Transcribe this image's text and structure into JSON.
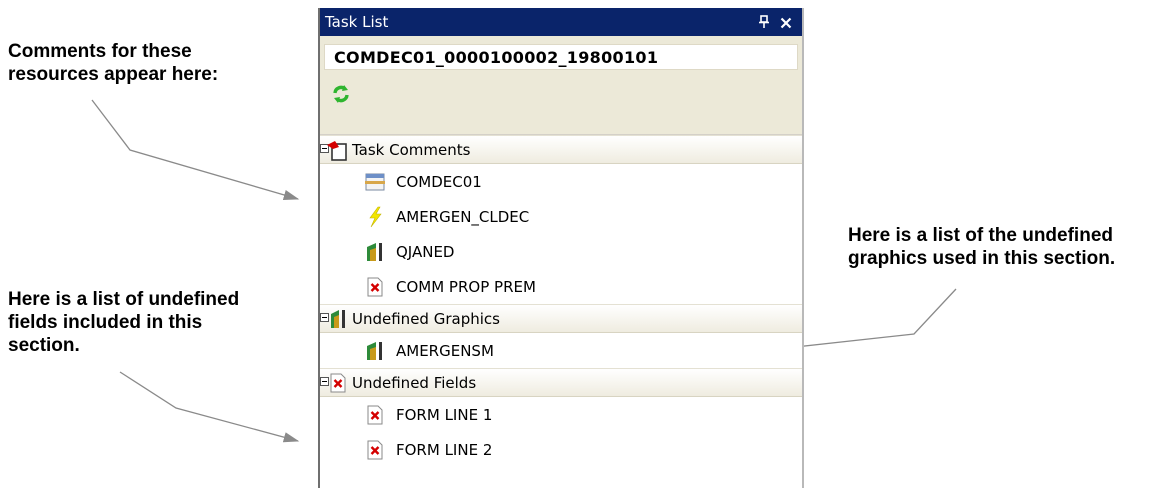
{
  "annotations": {
    "comments": [
      "Comments for these",
      "resources appear here:"
    ],
    "fields": [
      "Here is a list of undefined",
      "fields included in this",
      "section."
    ],
    "graphics": [
      "Here is a list of the undefined",
      "graphics used in this section."
    ]
  },
  "panel": {
    "title": "Task List",
    "pin_glyph": "⼌",
    "close_glyph": "✕",
    "resource_name": "COMDEC01_0000100002_19800101"
  },
  "groups": [
    {
      "label": "Task Comments",
      "icon": "task-comments-icon",
      "items": [
        {
          "label": "COMDEC01",
          "icon": "form-icon"
        },
        {
          "label": "AMERGEN_CLDEC",
          "icon": "lightning-icon"
        },
        {
          "label": "QJANED",
          "icon": "graphic-icon"
        },
        {
          "label": "COMM PROP PREM",
          "icon": "field-icon"
        }
      ]
    },
    {
      "label": "Undefined Graphics",
      "icon": "undefined-graphics-icon",
      "items": [
        {
          "label": "AMERGENSM",
          "icon": "graphic-icon"
        }
      ]
    },
    {
      "label": "Undefined Fields",
      "icon": "undefined-fields-icon",
      "items": [
        {
          "label": "FORM LINE 1",
          "icon": "field-icon"
        },
        {
          "label": "FORM LINE 2",
          "icon": "field-icon"
        }
      ]
    }
  ],
  "colors": {
    "titlebar": "#0a246a",
    "header_bg": "#ece9d8",
    "refresh_green": "#2fb52f",
    "field_red": "#d40000",
    "lightning": "#f2e600",
    "graphic_gold": "#c89a1a",
    "graphic_green": "#2e8b3a"
  }
}
